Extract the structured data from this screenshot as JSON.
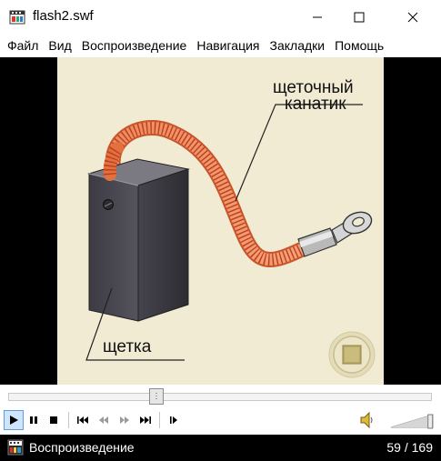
{
  "window": {
    "title": "flash2.swf"
  },
  "menu": {
    "items": [
      "Файл",
      "Вид",
      "Воспроизведение",
      "Навигация",
      "Закладки",
      "Помощь"
    ]
  },
  "movie": {
    "labels": {
      "cable_line1": "щеточный",
      "cable_line2": "канатик",
      "brush": "щетка"
    }
  },
  "player": {
    "progress_fraction": 0.35,
    "volume_fraction": 0.95,
    "controls": [
      "play-icon",
      "pause-icon",
      "stop-icon",
      "skip-to-start-icon",
      "rewind-icon",
      "fast-forward-icon",
      "skip-to-end-icon",
      "step-forward-icon"
    ],
    "active_control": "play-icon"
  },
  "status": {
    "text": "Воспроизведение",
    "frame_counter": "59 / 169"
  }
}
